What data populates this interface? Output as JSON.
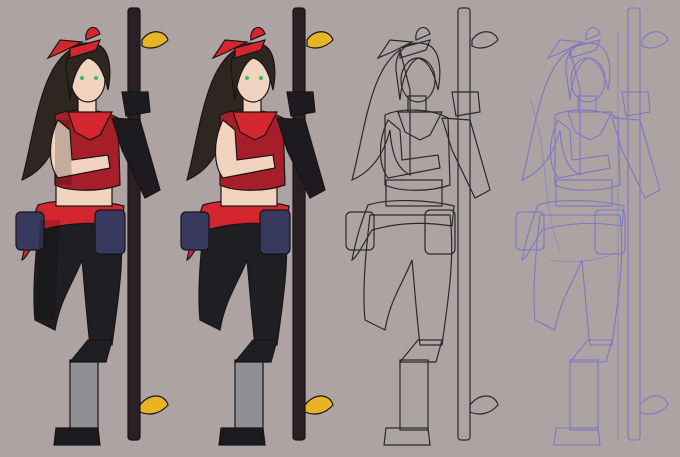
{
  "image": {
    "background_color": "#ada3a3",
    "panels": [
      {
        "stage": "colored-with-shading",
        "colors": {
          "hair": "#2e2620",
          "top": "#a51e2a",
          "scarf": "#d4262f",
          "pants": "#1f1f23",
          "pouch": "#37395e",
          "staff": "#2a2024",
          "feather": "#e8b423",
          "wraps": "#8f8f95",
          "skin": "#f1d3c0",
          "eyes": "#2fbf6a"
        }
      },
      {
        "stage": "flat-colors",
        "colors": {
          "hair": "#2e2620",
          "top": "#a51e2a",
          "scarf": "#d4262f",
          "pants": "#1f1f23",
          "pouch": "#37395e",
          "staff": "#2a2024",
          "feather": "#e8b423",
          "wraps": "#8f8f95",
          "skin": "#f1d3c0",
          "eyes": "#2fbf6a"
        }
      },
      {
        "stage": "lineart",
        "colors": {
          "line": "#2a2a2a",
          "fill": "#ada3a3"
        }
      },
      {
        "stage": "rough-sketch",
        "colors": {
          "line": "#7d78c2"
        }
      }
    ]
  }
}
